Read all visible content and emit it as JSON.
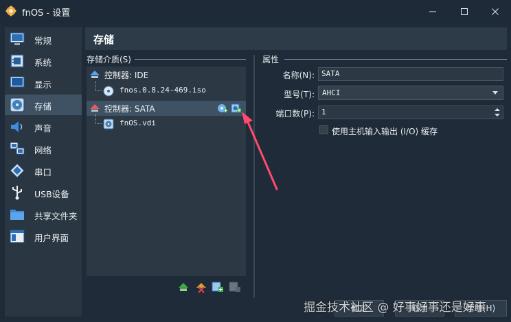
{
  "window": {
    "title": "fnOS - 设置",
    "icon": "gear-flower-icon",
    "controls": [
      "minimize",
      "maximize",
      "close"
    ]
  },
  "sidebar": {
    "items": [
      {
        "label": "常规",
        "icon": "monitor-icon"
      },
      {
        "label": "系统",
        "icon": "chip-icon"
      },
      {
        "label": "显示",
        "icon": "display-icon"
      },
      {
        "label": "存储",
        "icon": "disk-icon",
        "selected": true
      },
      {
        "label": "声音",
        "icon": "speaker-icon"
      },
      {
        "label": "网络",
        "icon": "network-icon"
      },
      {
        "label": "串口",
        "icon": "serial-port-icon"
      },
      {
        "label": "USB设备",
        "icon": "usb-icon"
      },
      {
        "label": "共享文件夹",
        "icon": "folder-icon"
      },
      {
        "label": "用户界面",
        "icon": "window-ui-icon"
      }
    ]
  },
  "page": {
    "title": "存储"
  },
  "storage": {
    "group_label": "存储介质(S)",
    "tree": [
      {
        "label": "控制器: IDE",
        "type": "controller"
      },
      {
        "label": "fnos.0.8.24-469.iso",
        "type": "optical"
      },
      {
        "label": "控制器: SATA",
        "type": "controller",
        "selected": true
      },
      {
        "label": "fnOS.vdi",
        "type": "harddisk"
      }
    ],
    "row_actions": [
      "add-optical-drive-icon",
      "add-hard-disk-icon"
    ],
    "toolbar": [
      "add-controller-icon",
      "remove-controller-icon",
      "add-attachment-icon",
      "remove-attachment-icon"
    ]
  },
  "properties": {
    "group_label": "属性",
    "name_label": "名称(N):",
    "name_value": "SATA",
    "type_label": "型号(T):",
    "type_value": "AHCI",
    "port_label": "端口数(P):",
    "port_value": "1",
    "hostio_label": "使用主机输入输出 (I/O) 缓存",
    "hostio_checked": false
  },
  "footer": {
    "ok": "确定",
    "cancel": "取消",
    "help": "帮助(H)"
  },
  "watermark": "掘金技术社区 @ 好事好事还是好事",
  "colors": {
    "accent_selected": "#3e5263",
    "annotation_arrow": "#ff4b6e"
  }
}
